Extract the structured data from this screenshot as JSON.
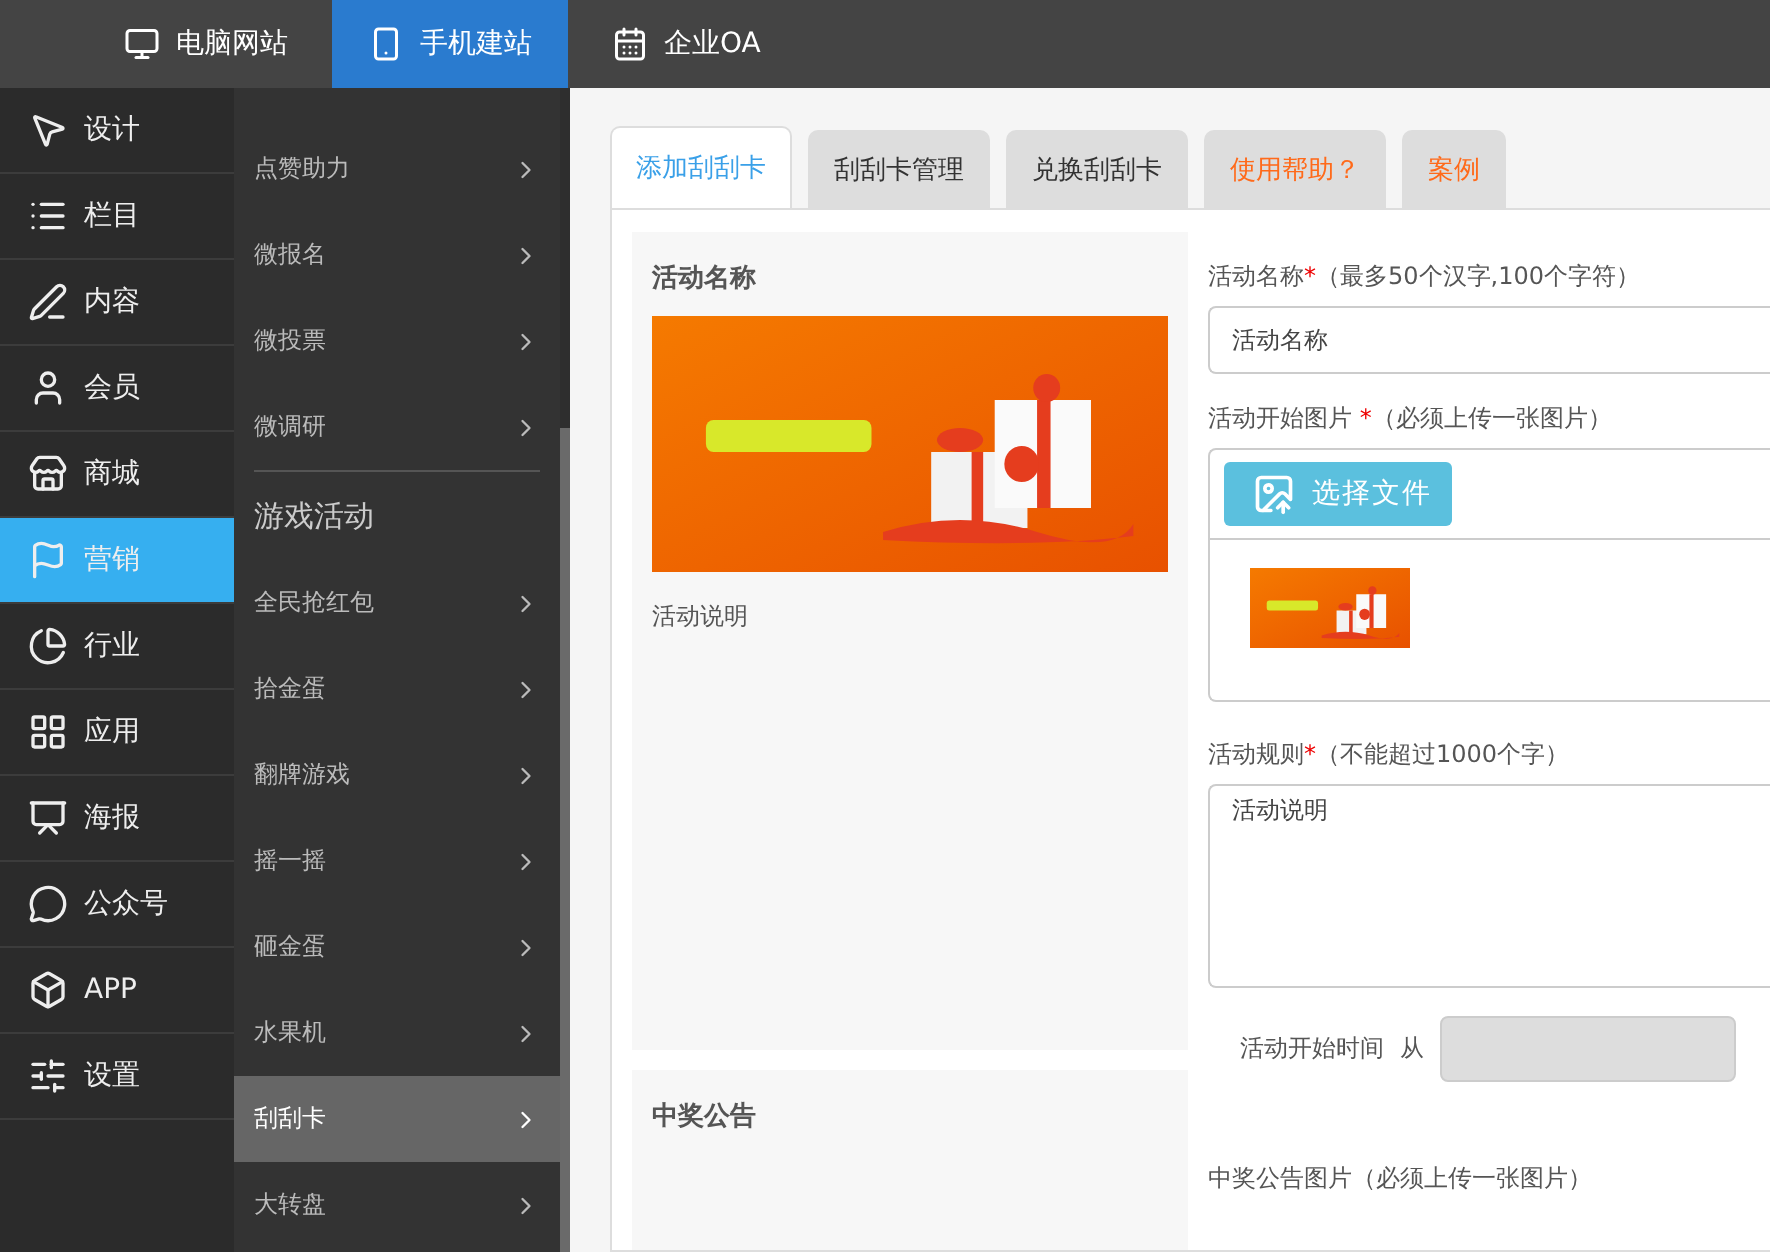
{
  "top_nav": [
    {
      "label": "电脑网站",
      "selected": false
    },
    {
      "label": "手机建站",
      "selected": true
    },
    {
      "label": "企业OA",
      "selected": false
    }
  ],
  "sidebar": {
    "items": [
      {
        "label": "设计",
        "selected": false
      },
      {
        "label": "栏目",
        "selected": false
      },
      {
        "label": "内容",
        "selected": false
      },
      {
        "label": "会员",
        "selected": false
      },
      {
        "label": "商城",
        "selected": false
      },
      {
        "label": "营销",
        "selected": true
      },
      {
        "label": "行业",
        "selected": false
      },
      {
        "label": "应用",
        "selected": false
      },
      {
        "label": "海报",
        "selected": false
      },
      {
        "label": "公众号",
        "selected": false
      },
      {
        "label": "APP",
        "selected": false
      },
      {
        "label": "设置",
        "selected": false
      }
    ]
  },
  "submenu": {
    "items": [
      {
        "kind": "item",
        "label": "点赞助力",
        "selected": false
      },
      {
        "kind": "item",
        "label": "微报名",
        "selected": false
      },
      {
        "kind": "item",
        "label": "微投票",
        "selected": false
      },
      {
        "kind": "item",
        "label": "微调研",
        "selected": false
      },
      {
        "kind": "heading",
        "label": "游戏活动"
      },
      {
        "kind": "item",
        "label": "全民抢红包",
        "selected": false
      },
      {
        "kind": "item",
        "label": "拾金蛋",
        "selected": false
      },
      {
        "kind": "item",
        "label": "翻牌游戏",
        "selected": false
      },
      {
        "kind": "item",
        "label": "摇一摇",
        "selected": false
      },
      {
        "kind": "item",
        "label": "砸金蛋",
        "selected": false
      },
      {
        "kind": "item",
        "label": "水果机",
        "selected": false
      },
      {
        "kind": "item",
        "label": "刮刮卡",
        "selected": true
      },
      {
        "kind": "item",
        "label": "大转盘",
        "selected": false
      }
    ]
  },
  "tabs": [
    {
      "label": "添加刮刮卡",
      "selected": true,
      "kind": "normal"
    },
    {
      "label": "刮刮卡管理",
      "selected": false,
      "kind": "normal"
    },
    {
      "label": "兑换刮刮卡",
      "selected": false,
      "kind": "normal"
    },
    {
      "label": "使用帮助？",
      "selected": false,
      "kind": "help"
    },
    {
      "label": "案例",
      "selected": false,
      "kind": "help"
    }
  ],
  "preview": {
    "title": "活动名称",
    "description": "活动说明"
  },
  "notice_card": {
    "title": "中奖公告"
  },
  "form": {
    "required_mark": "*",
    "fields": [
      {
        "kind": "text",
        "label": "活动名称",
        "required": true,
        "hint": "（最多50个汉字,100个字符）",
        "value": "活动名称"
      },
      {
        "kind": "upload",
        "label": "活动开始图片 ",
        "required": true,
        "hint": "（必须上传一张图片）",
        "button": "选择文件"
      },
      {
        "kind": "textarea",
        "label": "活动规则",
        "required": true,
        "hint": "（不能超过1000个字）",
        "value": "活动说明"
      },
      {
        "kind": "time",
        "label": "活动开始时间",
        "from": "从"
      },
      {
        "kind": "upload_cut",
        "label": "中奖公告图片",
        "required": false,
        "hint": "（必须上传一张图片）"
      }
    ]
  }
}
